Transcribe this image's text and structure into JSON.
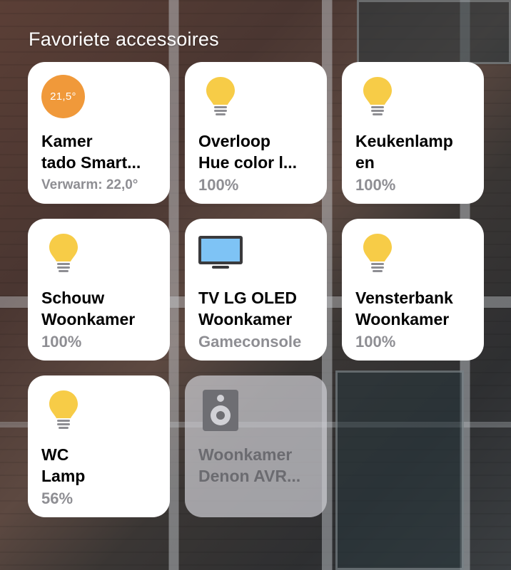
{
  "section": {
    "title": "Favoriete accessoires"
  },
  "colors": {
    "bulb": "#f7cc47",
    "thermostat": "#f0993a",
    "tv_screen": "#7ec3f5",
    "status": "#8e8e93"
  },
  "tiles": [
    {
      "icon": "thermostat-icon",
      "badge": "21,5°",
      "line1": "Kamer",
      "line2": "tado Smart...",
      "status": "Verwarm: 22,0°",
      "on": true
    },
    {
      "icon": "lightbulb-icon",
      "line1": "Overloop",
      "line2": "Hue color l...",
      "status": "100%",
      "on": true
    },
    {
      "icon": "lightbulb-icon",
      "line1": "Keukenlamp",
      "line2": "en",
      "status": "100%",
      "on": true
    },
    {
      "icon": "lightbulb-icon",
      "line1": "Schouw",
      "line2": "Woonkamer",
      "status": "100%",
      "on": true
    },
    {
      "icon": "tv-icon",
      "line1": "TV LG OLED",
      "line2": "Woonkamer",
      "status": "Gameconsole",
      "on": true
    },
    {
      "icon": "lightbulb-icon",
      "line1": "Vensterbank",
      "line2": "Woonkamer",
      "status": "100%",
      "on": true
    },
    {
      "icon": "lightbulb-icon",
      "line1": "WC",
      "line2": "Lamp",
      "status": "56%",
      "on": true
    },
    {
      "icon": "speaker-icon",
      "line1": "Woonkamer",
      "line2": "Denon AVR...",
      "status": "",
      "on": false
    }
  ]
}
